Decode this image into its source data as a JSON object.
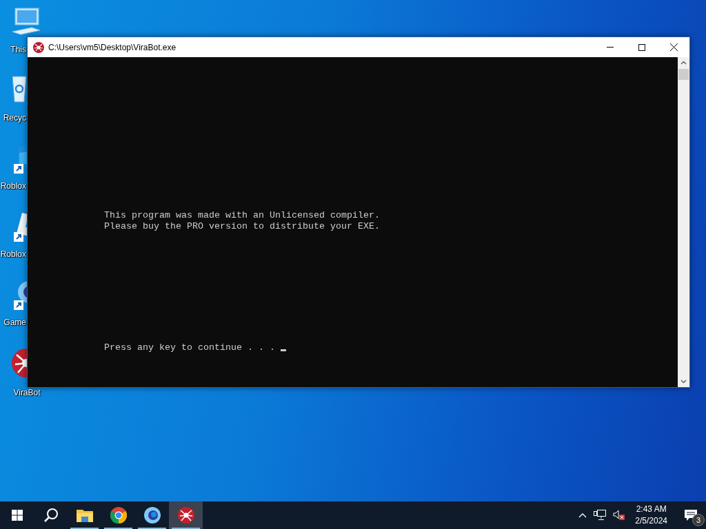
{
  "desktop_icons": [
    {
      "label": "This",
      "kind": "computer"
    },
    {
      "label": "Recyc",
      "kind": "recycle"
    },
    {
      "label": "Roblox",
      "kind": "roblox"
    },
    {
      "label": "Roblox",
      "kind": "studio"
    },
    {
      "label": "Game",
      "kind": "game"
    },
    {
      "label": "ViraBot",
      "kind": "virabot"
    }
  ],
  "window": {
    "title": "C:\\Users\\vm5\\Desktop\\ViraBot.exe",
    "console_lines": [
      "This program was made with an Unlicensed compiler.",
      "Please buy the PRO version to distribute your EXE."
    ],
    "prompt": "Press any key to continue . . .",
    "cursor": true
  },
  "taskbar": {
    "apps": [
      {
        "kind": "start",
        "running": false,
        "selected": false
      },
      {
        "kind": "search",
        "running": false,
        "selected": false
      },
      {
        "kind": "explorer",
        "running": true,
        "selected": false
      },
      {
        "kind": "chrome",
        "running": true,
        "selected": false
      },
      {
        "kind": "game",
        "running": true,
        "selected": false
      },
      {
        "kind": "virabot",
        "running": true,
        "selected": true
      }
    ],
    "time": "2:43 AM",
    "date": "2/5/2024",
    "notifications": "3",
    "volume_muted": true
  }
}
